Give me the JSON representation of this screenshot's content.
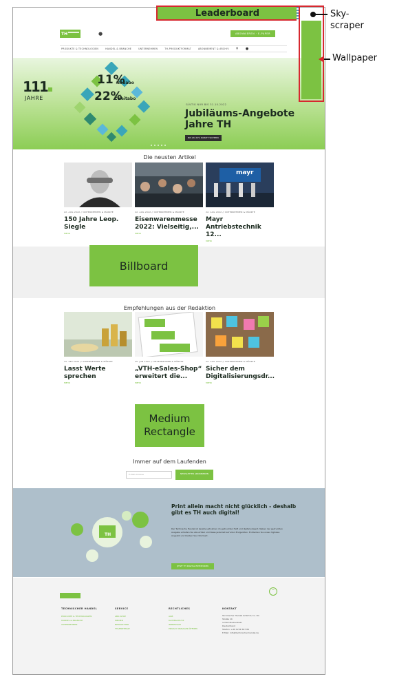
{
  "annotations": {
    "leaderboard": "Leaderboard",
    "skyscraper": "Sky-\nscraper",
    "wallpaper": "Wallpaper",
    "billboard": "Billboard",
    "medium_rectangle": "Medium\nRectangle"
  },
  "header": {
    "logo_mark": "TH",
    "cta": "ABONNIEREN · E-PAPER",
    "nav": [
      "PRODUKTE & TECHNOLOGIEN",
      "HANDEL & BRANCHE",
      "UNTERNEHMEN",
      "TH-PRODUKTFORMAT",
      "ABONNEMENT & ARCHIV"
    ]
  },
  "hero": {
    "big": "111",
    "jahre": "JAHRE",
    "pct1": "11%",
    "pct1_small": "auf ein",
    "pct1_label": "Neuabo",
    "pct2": "22%",
    "pct2_small": "auf ein",
    "pct2_label": "Zweitabo",
    "kicker": "GÜLTIG NUR BIS 31.10.2022",
    "title": "Jubiläums-Angebote\nJahre TH",
    "button": "BIS ZU 22% RABATT SICHERN",
    "slides": 5
  },
  "newest": {
    "title": "Die neusten Artikel",
    "cards": [
      {
        "meta": "22. AUG 2022 // UNTERNEHMEN & MÄRKTE",
        "title": "150 Jahre Leop. Siegle",
        "more": "MEHR"
      },
      {
        "meta": "22. AUG 2022 // UNTERNEHMEN & MÄRKTE",
        "title": "Eisenwarenmesse 2022: Vielseitig,...",
        "more": "MEHR"
      },
      {
        "meta": "22. AUG 2022 // UNTERNEHMEN & MÄRKTE",
        "title": "Mayr Antriebstechnik 12...",
        "more": "MEHR"
      }
    ],
    "mayr_sign": "mayr"
  },
  "editorial": {
    "title": "Empfehlungen aus der Redaktion",
    "cards": [
      {
        "meta": "15. SEP 2020 // UNTERNEHMEN & MÄRKTE",
        "title": "Lasst Werte sprechen",
        "more": "MEHR"
      },
      {
        "meta": "25. JUN 2022 // UNTERNEHMEN & MÄRKTE",
        "title": "„VTH-eSales-Shop“ erweitert die...",
        "more": "MEHR"
      },
      {
        "meta": "22. AUG 2022 // UNTERNEHMEN & MÄRKTE",
        "title": "Sicher dem Digitalisierungsdr...",
        "more": "MEHR"
      }
    ]
  },
  "newsletter": {
    "title": "Immer auf dem Laufenden",
    "placeholder": "E-Mail-Adresse",
    "button": "NEWSLETTER ABONNIEREN"
  },
  "print": {
    "title": "Print allein macht nicht glücklich - deshalb gibt es TH auch digital!",
    "body": "Der Technische Handel ist bereits seit Jahren im gedruckten Heft und digital präsent. Neben der gedruckten Ausgabe erhalten Sie alle Artikel und News jederzeit auf allen Endgeräten. Entdecken Sie unser digitales Angebot und bleiben Sie informiert.",
    "button": "JETZT TH DIGITAL ENTDECKEN",
    "book_label": "TH"
  },
  "footer": {
    "up": "^",
    "cols": [
      {
        "head": "TECHNISCHER HANDEL",
        "links": [
          "PRODUKTE & TECHNOLOGIEN",
          "HANDEL & BRANCHE",
          "UNTERNEHMEN"
        ]
      },
      {
        "head": "SERVICE",
        "links": [
          "ABO-SHOP",
          "MEDIEN",
          "NEWSLETTER",
          "TH-ZERTIFIKAT"
        ]
      },
      {
        "head": "RECHTLICHES",
        "links": [
          "AGB",
          "DATENSCHUTZ",
          "IMPRESSUM",
          "PRIVACY MANAGER ÖFFNEN"
        ]
      },
      {
        "head": "KONTAKT",
        "lines": [
          "Technischer Handel GmbH & Co. KG",
          "Straße 14",
          "12345 Musterstadt",
          "Deutschland",
          "Telefon: +49 1234 567 89",
          "E-Mail: info@technischer-handel.de"
        ]
      }
    ]
  },
  "colors": {
    "accent": "#7cc242",
    "annotation_red": "#d7282f",
    "dark": "#1b2a1f",
    "print_bg": "#aebfcb"
  }
}
